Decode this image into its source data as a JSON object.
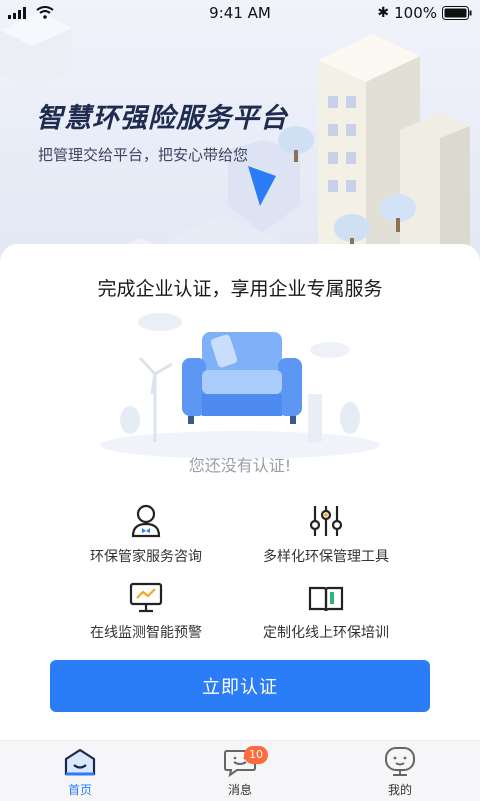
{
  "status_bar": {
    "time": "9:41 AM",
    "battery": "100%"
  },
  "hero": {
    "title": "智慧环强险服务平台",
    "subtitle": "把管理交给平台，把安心带给您"
  },
  "card": {
    "title": "完成企业认证，享用企业专属服务",
    "empty_state": "您还没有认证!",
    "features": [
      {
        "label": "环保管家服务咨询",
        "icon": "consultant-icon"
      },
      {
        "label": "多样化环保管理工具",
        "icon": "sliders-icon"
      },
      {
        "label": "在线监测智能预警",
        "icon": "monitor-chart-icon"
      },
      {
        "label": "定制化线上环保培训",
        "icon": "open-book-icon"
      }
    ],
    "cta_label": "立即认证"
  },
  "tabbar": {
    "tabs": [
      {
        "label": "首页",
        "icon": "home-icon",
        "active": true
      },
      {
        "label": "消息",
        "icon": "message-icon",
        "badge": "10"
      },
      {
        "label": "我的",
        "icon": "profile-icon"
      }
    ]
  },
  "colors": {
    "accent": "#2a7df6",
    "badge": "#ff6a3d",
    "title": "#1f2c4f"
  }
}
